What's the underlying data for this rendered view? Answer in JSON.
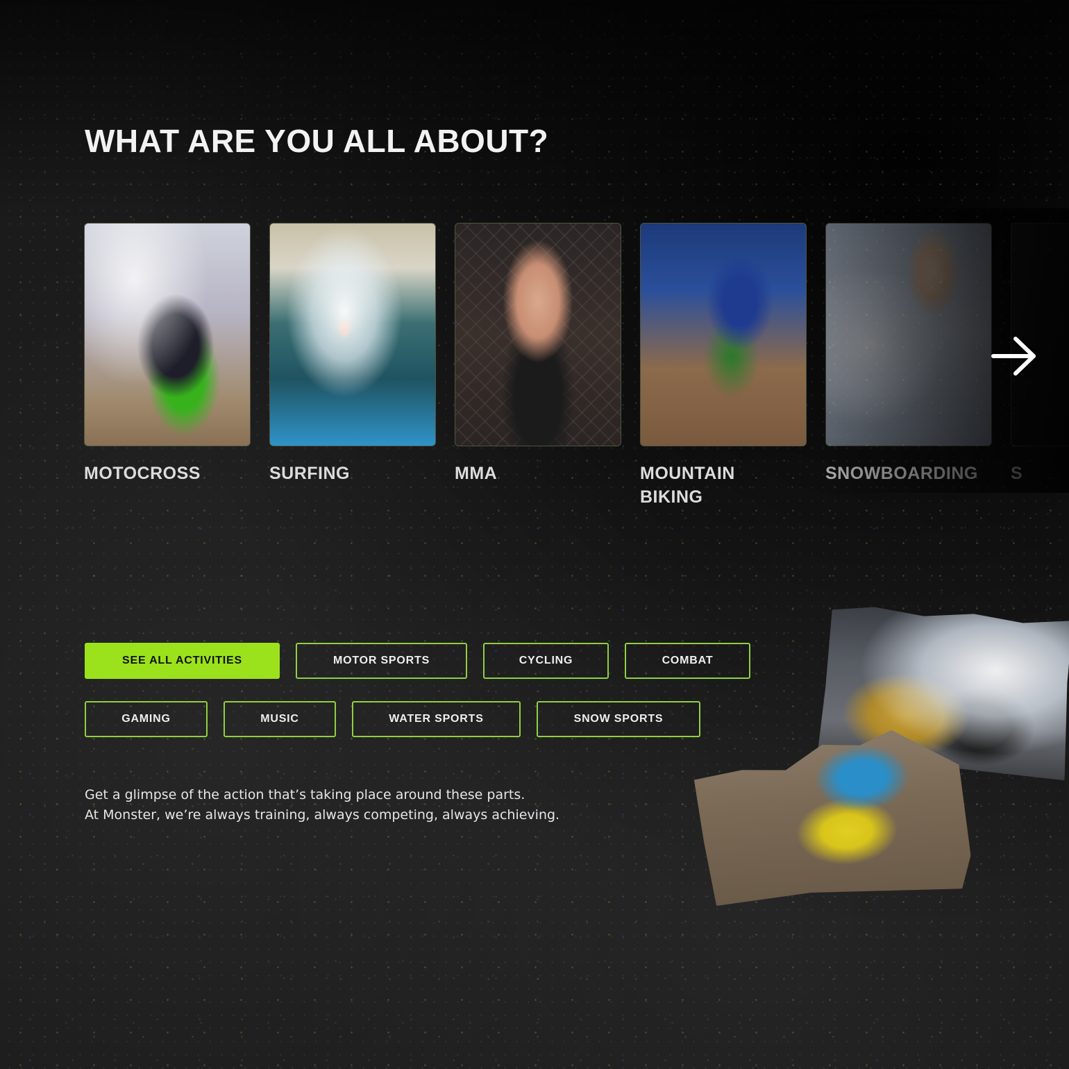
{
  "heading": "WHAT ARE YOU ALL ABOUT?",
  "carousel": {
    "items": [
      {
        "label": "MOTOCROSS",
        "image": "motocross-rider-photo"
      },
      {
        "label": "SURFING",
        "image": "surfer-wave-photo"
      },
      {
        "label": "MMA",
        "image": "mma-fighter-photo"
      },
      {
        "label": "MOUNTAIN BIKING",
        "image": "mountain-bike-rider-photo"
      },
      {
        "label": "SNOWBOARDING",
        "image": "snowboarder-photo"
      },
      {
        "label": "S",
        "image": "next-card-photo"
      }
    ],
    "next_icon": "arrow-right-icon"
  },
  "filters": {
    "row1": [
      {
        "label": "SEE ALL ACTIVITIES",
        "active": true
      },
      {
        "label": "MOTOR SPORTS",
        "active": false
      },
      {
        "label": "CYCLING",
        "active": false
      },
      {
        "label": "COMBAT",
        "active": false
      }
    ],
    "row2": [
      {
        "label": "GAMING",
        "active": false
      },
      {
        "label": "MUSIC",
        "active": false
      },
      {
        "label": "WATER SPORTS",
        "active": false
      },
      {
        "label": "SNOW SPORTS",
        "active": false
      }
    ]
  },
  "intro": {
    "line1": "Get a glimpse of the action that’s taking place around these parts.",
    "line2": "At Monster, we’re always training, always competing, always achieving."
  },
  "colors": {
    "accent": "#9be21c",
    "pill_border": "#8fd13f",
    "background": "#1b1b1c",
    "text": "#f2f2f2"
  }
}
